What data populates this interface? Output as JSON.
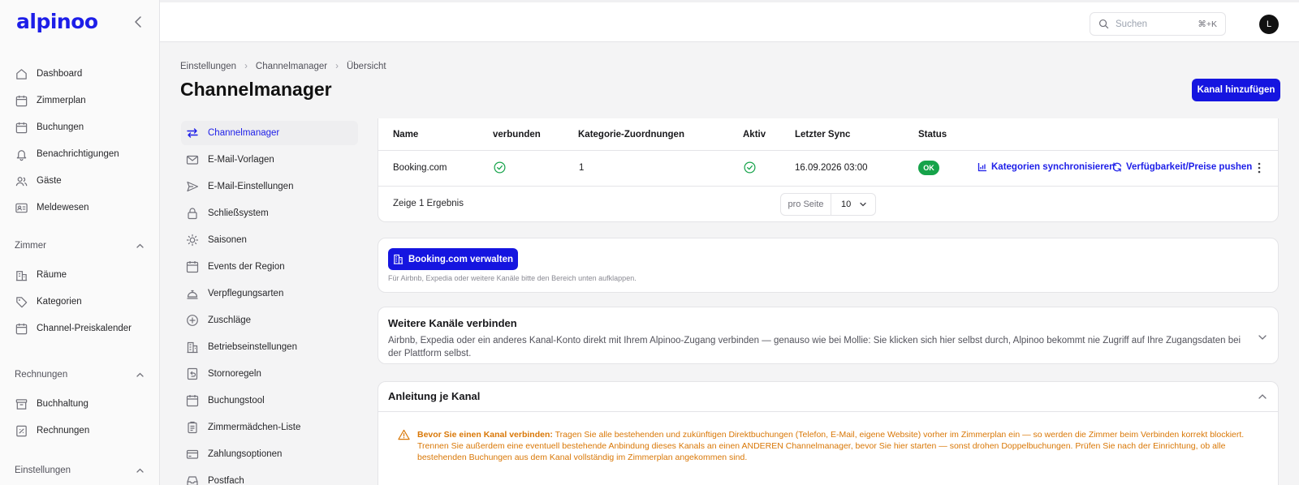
{
  "brand": {
    "logo": "alpinoo"
  },
  "sidebar": {
    "main_items": [
      {
        "label": "Dashboard",
        "icon": "home-icon"
      },
      {
        "label": "Zimmerplan",
        "icon": "calendar-icon"
      },
      {
        "label": "Buchungen",
        "icon": "calendar-icon"
      },
      {
        "label": "Benachrichtigungen",
        "icon": "bell-icon"
      },
      {
        "label": "Gäste",
        "icon": "users-icon"
      },
      {
        "label": "Meldewesen",
        "icon": "id-card-icon"
      }
    ],
    "sections": [
      {
        "title": "Zimmer",
        "items": [
          {
            "label": "Räume",
            "icon": "building-icon"
          },
          {
            "label": "Kategorien",
            "icon": "tag-icon"
          },
          {
            "label": "Channel-Preiskalender",
            "icon": "calendar-icon"
          }
        ]
      },
      {
        "title": "Rechnungen",
        "items": [
          {
            "label": "Buchhaltung",
            "icon": "archive-icon"
          },
          {
            "label": "Rechnungen",
            "icon": "invoice-icon"
          }
        ]
      },
      {
        "title": "Einstellungen",
        "items": []
      }
    ]
  },
  "topbar": {
    "search_placeholder": "Suchen",
    "search_shortcut": "⌘+K",
    "avatar_initial": "L"
  },
  "breadcrumb": [
    "Einstellungen",
    "Channelmanager",
    "Übersicht"
  ],
  "page_title": "Channelmanager",
  "add_channel_button": "Kanal hinzufügen",
  "settings_nav": [
    {
      "label": "Channelmanager",
      "icon": "arrows-swap-icon",
      "active": true
    },
    {
      "label": "E-Mail-Vorlagen",
      "icon": "mail-icon"
    },
    {
      "label": "E-Mail-Einstellungen",
      "icon": "send-icon"
    },
    {
      "label": "Schließsystem",
      "icon": "lock-icon"
    },
    {
      "label": "Saisonen",
      "icon": "sun-icon"
    },
    {
      "label": "Events der Region",
      "icon": "calendar-icon"
    },
    {
      "label": "Verpflegungsarten",
      "icon": "dish-icon"
    },
    {
      "label": "Zuschläge",
      "icon": "plus-circle-icon"
    },
    {
      "label": "Betriebseinstellungen",
      "icon": "building-icon"
    },
    {
      "label": "Stornoregeln",
      "icon": "undo-doc-icon"
    },
    {
      "label": "Buchungstool",
      "icon": "calendar-icon"
    },
    {
      "label": "Zimmermädchen-Liste",
      "icon": "clipboard-icon"
    },
    {
      "label": "Zahlungsoptionen",
      "icon": "credit-card-icon"
    },
    {
      "label": "Postfach",
      "icon": "inbox-icon"
    }
  ],
  "table": {
    "columns": [
      "Name",
      "verbunden",
      "Kategorie-Zuordnungen",
      "Aktiv",
      "Letzter Sync",
      "Status"
    ],
    "rows": [
      {
        "name": "Booking.com",
        "verbunden": true,
        "zuordnungen": "1",
        "aktiv": true,
        "last_sync": "16.09.2026 03:00",
        "status": "OK"
      }
    ],
    "actions": {
      "sync_categories": "Kategorien synchronisieren",
      "push": "Verfügbarkeit/Preise pushen"
    },
    "result_text": "Zeige 1 Ergebnis",
    "per_page_label": "pro Seite",
    "per_page_value": "10"
  },
  "booking_card": {
    "button": "Booking.com verwalten",
    "hint": "Für Airbnb, Expedia oder weitere Kanäle bitte den Bereich unten aufklappen."
  },
  "more_channels": {
    "title": "Weitere Kanäle verbinden",
    "description": "Airbnb, Expedia oder ein anderes Kanal-Konto direkt mit Ihrem Alpinoo-Zugang verbinden — genauso wie bei Mollie: Sie klicken sich hier selbst durch, Alpinoo bekommt nie Zugriff auf Ihre Zugangsdaten bei der Plattform selbst."
  },
  "guide": {
    "title": "Anleitung je Kanal",
    "warning_bold": "Bevor Sie einen Kanal verbinden:",
    "warning_text": "Tragen Sie alle bestehenden und zukünftigen Direktbuchungen (Telefon, E-Mail, eigene Website) vorher im Zimmerplan ein — so werden die Zimmer beim Verbinden korrekt blockiert. Trennen Sie außerdem eine eventuell bestehende Anbindung dieses Kanals an einen ANDEREN Channelmanager, bevor Sie hier starten — sonst drohen Doppelbuchungen. Prüfen Sie nach der Einrichtung, ob alle bestehenden Buchungen aus dem Kanal vollständig im Zimmerplan angekommen sind."
  },
  "colors": {
    "accent": "#1515e0",
    "success": "#16a34a",
    "warning": "#d97706"
  }
}
